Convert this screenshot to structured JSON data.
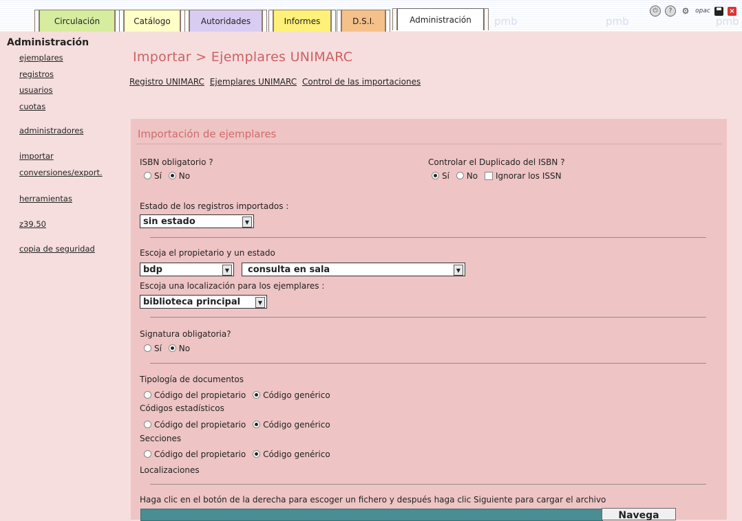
{
  "tabs": [
    {
      "label": "Circulación",
      "color": "#d6ec9e"
    },
    {
      "label": "Catálogo",
      "color": "#ffffc8"
    },
    {
      "label": "Autoridades",
      "color": "#d9ccf3"
    },
    {
      "label": "Informes",
      "color": "#fff07a"
    },
    {
      "label": "D.S.I.",
      "color": "#f5c08a"
    },
    {
      "label": "Administración",
      "color": "#ffffff"
    }
  ],
  "watermark": "pmb",
  "top_icons": [
    "exit-icon",
    "help-icon",
    "gear-icon",
    "opac",
    "save-icon",
    "close-icon"
  ],
  "sidebar": {
    "heading": "Administración",
    "items": [
      "ejemplares",
      "registros",
      "usuarios",
      "cuotas",
      "administradores",
      "importar",
      "conversiones/export.",
      "herramientas",
      "z39.50",
      "copia de seguridad"
    ]
  },
  "page": {
    "title": "Importar > Ejemplares UNIMARC",
    "sublinks": [
      "Registro UNIMARC",
      "Ejemplares UNIMARC",
      "Control de las importaciones"
    ]
  },
  "form": {
    "title": "Importación de ejemplares",
    "isbn_label": "ISBN obligatorio ?",
    "isbn_yes": "Sí",
    "isbn_no": "No",
    "dup_label": "Controlar el Duplicado del ISBN ?",
    "dup_yes": "Sí",
    "dup_no": "No",
    "dup_issn": "Ignorar los ISSN",
    "estado_label": "Estado de los registros importados :",
    "estado_value": "sin estado",
    "owner_label": "Escoja el propietario y un estado",
    "owner_value": "bdp",
    "owner_state_value": "consulta en sala",
    "loc_label": "Escoja una localización para los ejemplares :",
    "loc_value": "biblioteca principal",
    "sig_label": "Signatura obligatoria?",
    "sig_yes": "Sí",
    "sig_no": "No",
    "tipologia_label": "Tipología de documentos",
    "codigos_label": "Códigos estadísticos",
    "secciones_label": "Secciones",
    "localizaciones_label": "Localizaciones",
    "opt_owner": "Código del propietario",
    "opt_generic": "Código genérico",
    "file_instructions": "Haga clic en el botón de la derecha para escoger un fichero y después haga clic Siguiente para cargar el archivo",
    "browse_label": "Navega"
  }
}
